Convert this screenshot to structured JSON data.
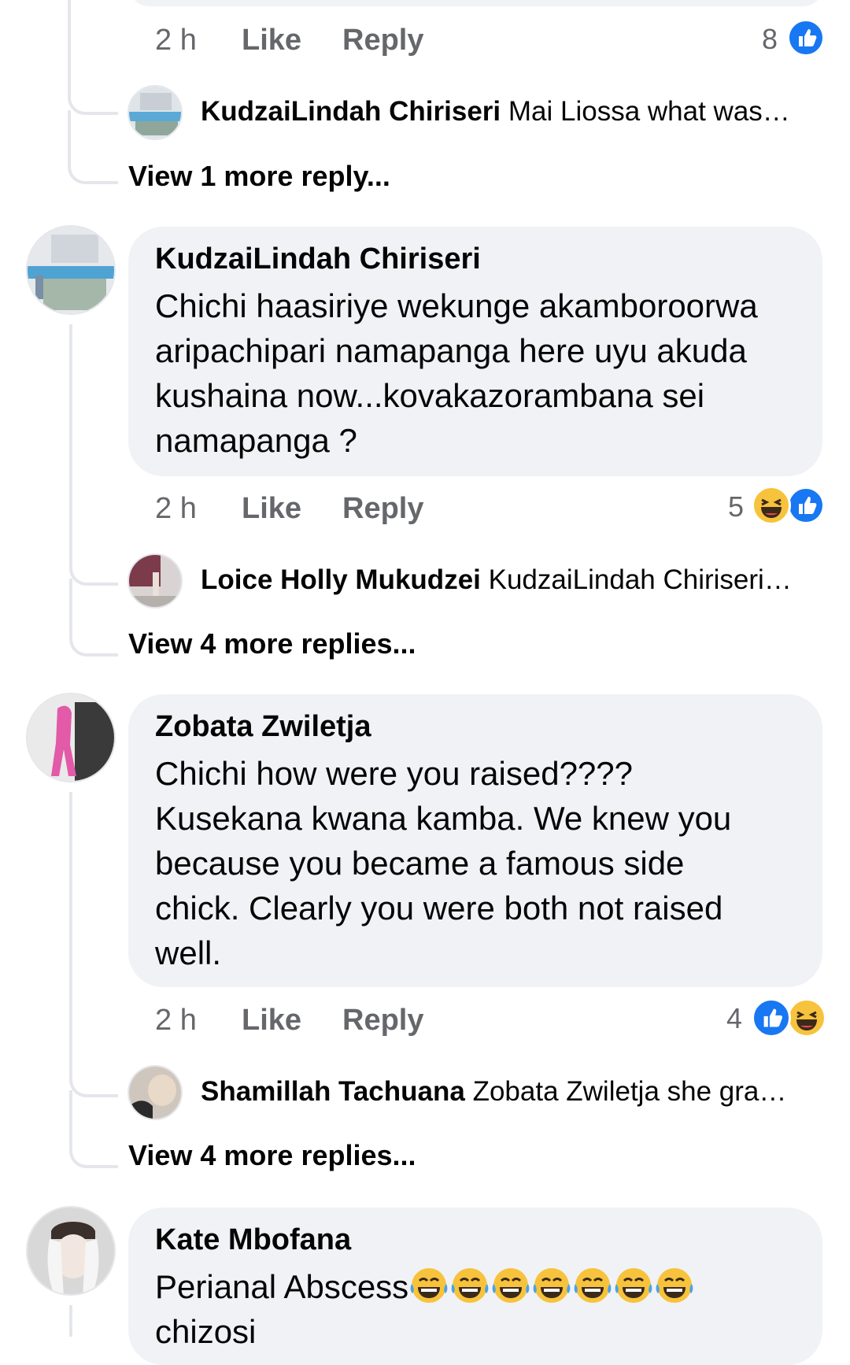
{
  "top_fragment": {
    "time": "2 h",
    "like": "Like",
    "reply": "Reply",
    "reaction_count": "8",
    "reaction_icons": [
      "like-icon"
    ],
    "reply_preview": {
      "author": "KudzaiLindah Chiriseri",
      "text": "Mai Liossa what was…"
    },
    "view_more": "View 1 more reply..."
  },
  "comments": [
    {
      "author": "KudzaiLindah Chiriseri",
      "text": "Chichi haasiriye wekunge akamboroorwa\naripachipari namapanga here uyu akuda\nkushaina now...kovakazorambana sei\nnamapanga ?",
      "time": "2 h",
      "like": "Like",
      "reply": "Reply",
      "reaction_count": "5",
      "reaction_icons": [
        "haha-icon",
        "like-icon"
      ],
      "reply_preview": {
        "author": "Loice Holly Mukudzei",
        "text": "KudzaiLindah Chiriseri…"
      },
      "view_more": "View 4 more replies..."
    },
    {
      "author": "Zobata Zwiletja",
      "text": "Chichi how were you raised????\nKusekana kwana kamba.  We knew you\nbecause you became a famous side\nchick.  Clearly you were both not raised\nwell.",
      "time": "2 h",
      "like": "Like",
      "reply": "Reply",
      "reaction_count": "4",
      "reaction_icons": [
        "like-icon",
        "haha-icon"
      ],
      "reply_preview": {
        "author": "Shamillah Tachuana",
        "text": "Zobata Zwiletja she gra…"
      },
      "view_more": "View 4 more replies..."
    },
    {
      "author": "Kate Mbofana",
      "text": "Perianal Abscess",
      "emoji_count": 7,
      "emoji_name": "tears-of-joy-emoji",
      "continuation": "chizosi"
    }
  ],
  "colors": {
    "bubble": "#f0f2f5",
    "meta_text": "#65676b",
    "thread_line": "#e4e6eb",
    "like_blue": "#1877f2",
    "haha_yellow": "#f7c33c"
  }
}
